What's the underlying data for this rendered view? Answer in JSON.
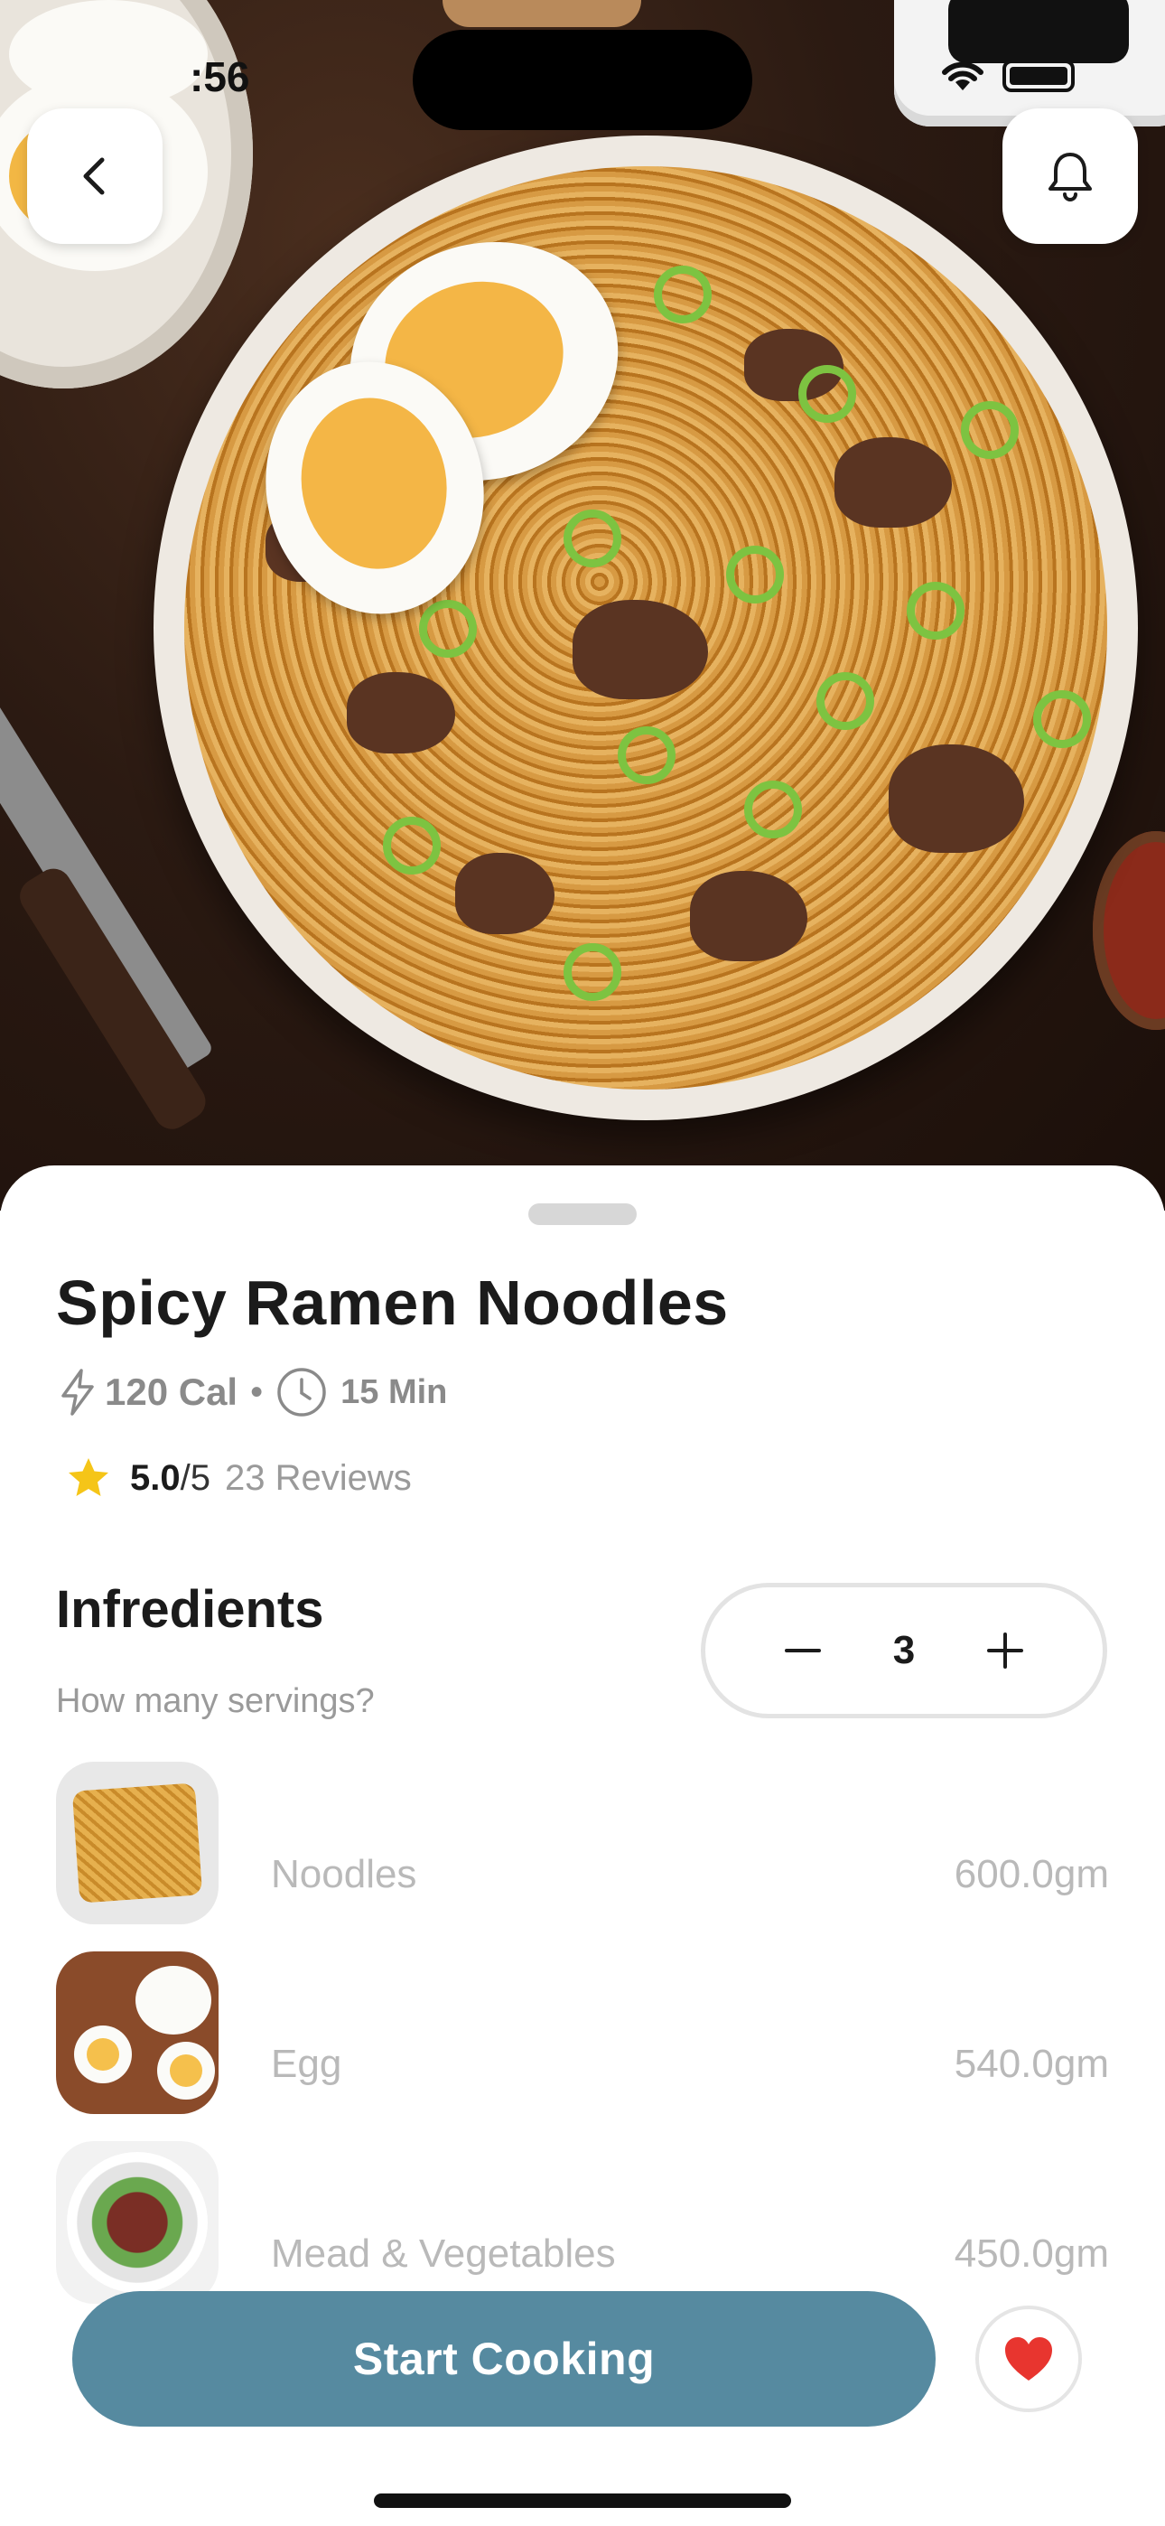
{
  "status_bar": {
    "time": ":56"
  },
  "hero": {
    "image_alt": "Spicy ramen noodles bowl"
  },
  "recipe": {
    "title": "Spicy Ramen Noodles",
    "calories": "120 Cal",
    "separator": "•",
    "time": "15 Min",
    "rating_score": "5.0",
    "rating_out_of": "/5",
    "reviews": "23 Reviews"
  },
  "ingredients_section": {
    "title": "Infredients",
    "servings_question": "How many servings?",
    "servings": "3",
    "items": [
      {
        "name": "Noodles",
        "amount": "600.0gm"
      },
      {
        "name": "Egg",
        "amount": "540.0gm"
      },
      {
        "name": "Mead & Vegetables",
        "amount": "450.0gm"
      }
    ]
  },
  "actions": {
    "start_label": "Start Cooking"
  },
  "colors": {
    "primary": "#568aa0",
    "heart": "#e8352f",
    "star": "#f5c518"
  }
}
